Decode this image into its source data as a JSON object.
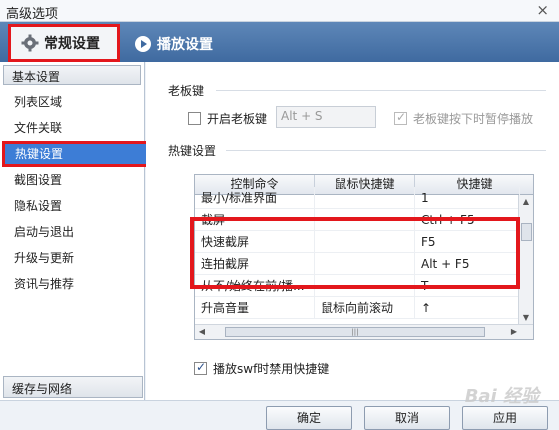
{
  "window": {
    "title": "高级选项",
    "close_glyph": "×"
  },
  "tabs": [
    {
      "label": "常规设置",
      "icon": "gear-icon",
      "active": true
    },
    {
      "label": "播放设置",
      "icon": "play-settings-icon",
      "active": false
    }
  ],
  "sidebar": {
    "header": "基本设置",
    "items": [
      {
        "label": "列表区域"
      },
      {
        "label": "文件关联"
      },
      {
        "label": "热键设置",
        "active": true
      },
      {
        "label": "截图设置"
      },
      {
        "label": "隐私设置"
      },
      {
        "label": "启动与退出"
      },
      {
        "label": "升级与更新"
      },
      {
        "label": "资讯与推荐"
      }
    ],
    "footer": "缓存与网络"
  },
  "bosskey": {
    "section_label": "老板键",
    "enable_label": "开启老板键",
    "enable_checked": false,
    "hotkey_value": "Alt + S",
    "pause_label": "老板键按下时暂停播放",
    "pause_checked": true
  },
  "hotkeys": {
    "section_label": "热键设置",
    "columns": [
      "控制命令",
      "鼠标快捷键",
      "快捷键"
    ],
    "rows": [
      {
        "command": "最小/标准界面",
        "mouse": "",
        "key": "1"
      },
      {
        "command": "截屏",
        "mouse": "",
        "key": "Ctrl + F5"
      },
      {
        "command": "快速截屏",
        "mouse": "",
        "key": "F5"
      },
      {
        "command": "连拍截屏",
        "mouse": "",
        "key": "Alt + F5"
      },
      {
        "command": "从不/始终在前/播...",
        "mouse": "",
        "key": "T"
      },
      {
        "command": "升高音量",
        "mouse": "鼠标向前滚动",
        "key": "↑"
      }
    ]
  },
  "swf": {
    "label": "播放swf时禁用快捷键",
    "checked": true
  },
  "buttons": {
    "ok": "确定",
    "cancel": "取消",
    "apply": "应用"
  },
  "watermark": "Bai 经验",
  "colors": {
    "accent": "#3d7dd6",
    "highlight_red": "#e3171c",
    "tab_bar": "#4a76ad"
  }
}
